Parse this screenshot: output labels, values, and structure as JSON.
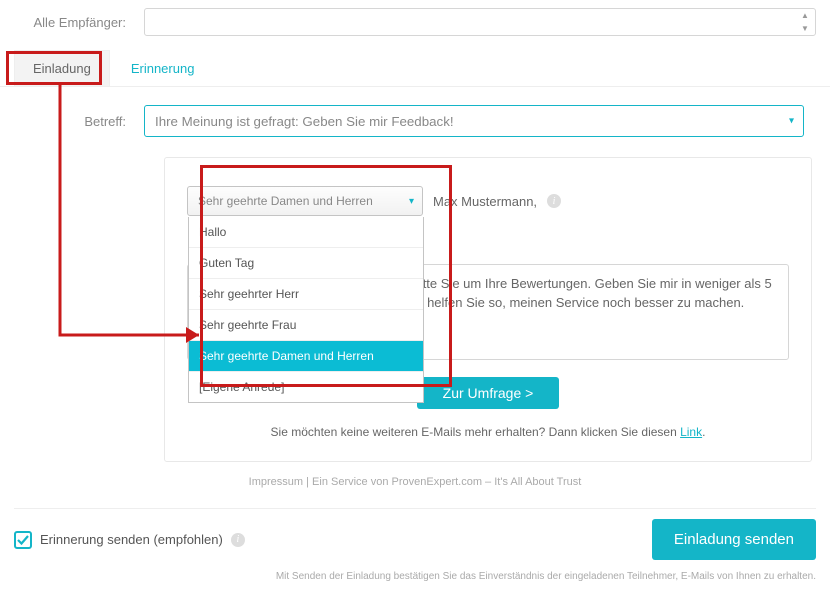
{
  "recipients": {
    "label": "Alle Empfänger:"
  },
  "tabs": {
    "invitation": "Einladung",
    "reminder": "Erinnerung"
  },
  "betreff": {
    "label": "Betreff:",
    "value": "Ihre Meinung ist gefragt: Geben Sie mir Feedback!"
  },
  "salutation": {
    "selected": "Sehr geehrte Damen und Herren",
    "options": [
      "Hallo",
      "Guten Tag",
      "Sehr geehrter Herr",
      "Sehr geehrte Frau",
      "Sehr geehrte Damen und Herren",
      "[Eigene Anrede]"
    ],
    "selected_index": 4
  },
  "recipient_name": "Max Mustermann,",
  "message": "Ihre Meinung ist mir sehr wichtig: Ich bitte Sie um Ihre Bewertungen. Geben Sie mir in weniger als 5 Minuten Ihr persönliches Feedback. So helfen Sie so, meinen Service noch besser zu machen.",
  "buttons": {
    "to_survey": "Zur Umfrage >",
    "send": "Einladung senden"
  },
  "optout": {
    "text_before": "Sie möchten keine weiteren E-Mails mehr erhalten? Dann klicken Sie diesen ",
    "link": "Link",
    "text_after": "."
  },
  "footer": "Impressum | Ein Service von ProvenExpert.com – It's All About Trust",
  "reminder_checkbox": {
    "label": "Erinnerung senden (empfohlen)",
    "checked": true
  },
  "disclaimer": "Mit Senden der Einladung bestätigen Sie das Einverständnis der eingeladenen Teilnehmer, E-Mails von Ihnen zu erhalten."
}
